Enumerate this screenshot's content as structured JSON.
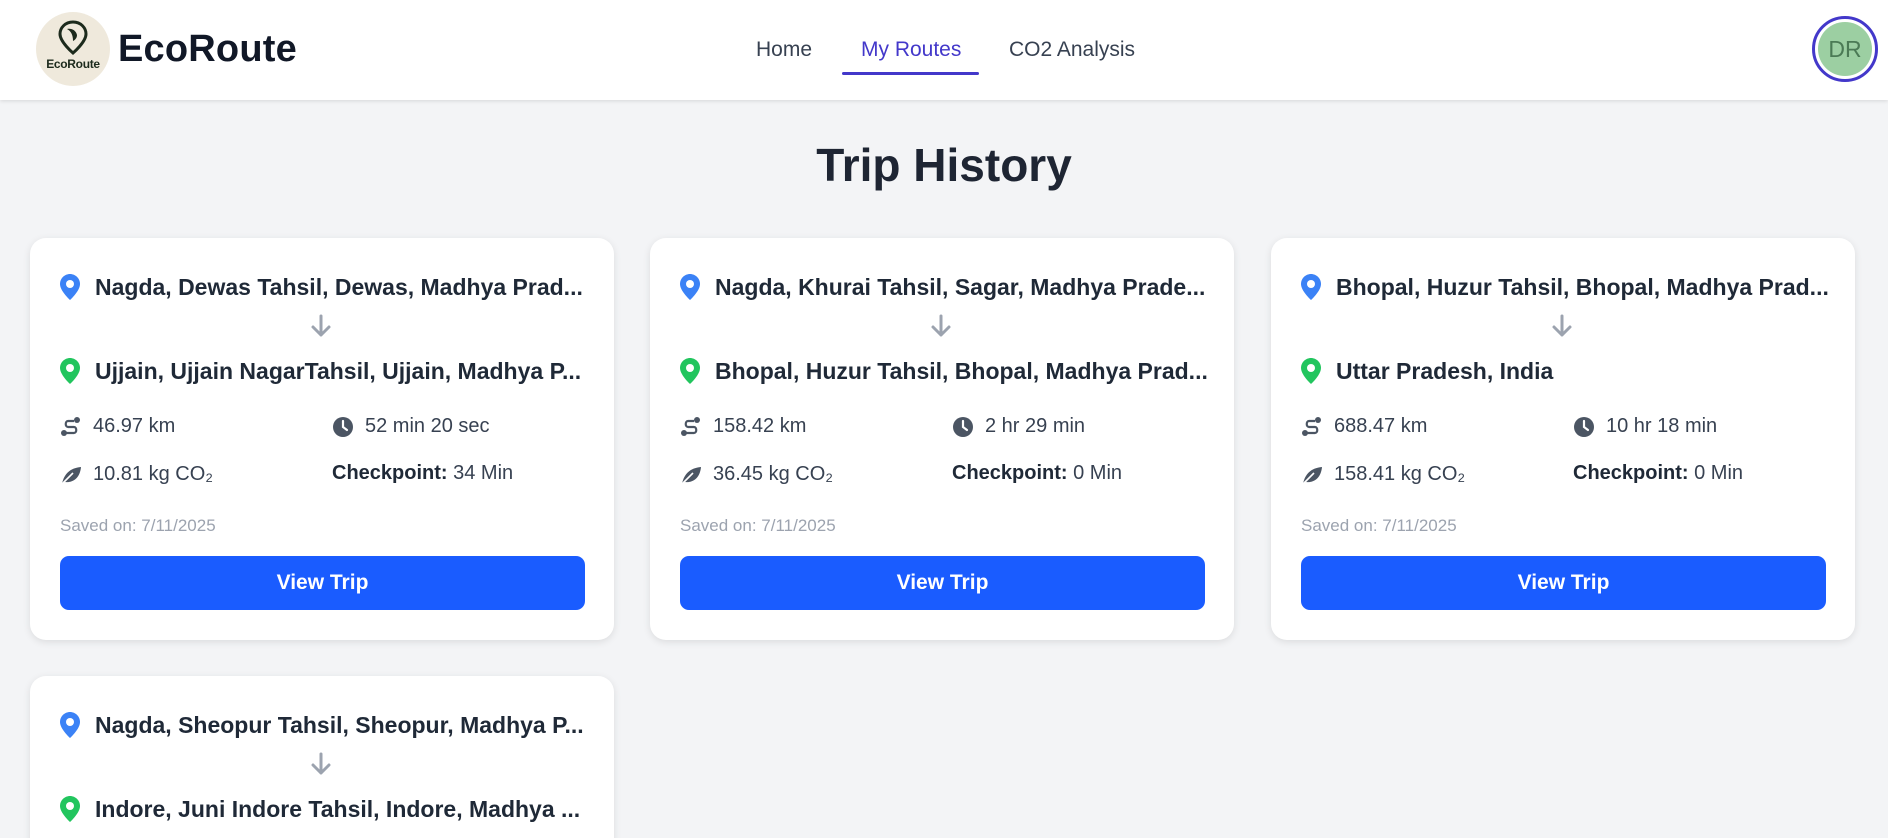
{
  "app": {
    "logo_text": "EcoRoute",
    "brand": "EcoRoute"
  },
  "nav": {
    "items": [
      {
        "label": "Home",
        "active": false
      },
      {
        "label": "My Routes",
        "active": true
      },
      {
        "label": "CO2 Analysis",
        "active": false
      }
    ]
  },
  "user": {
    "initials": "DR"
  },
  "page": {
    "title": "Trip History"
  },
  "labels": {
    "checkpoint": "Checkpoint:",
    "view_trip": "View Trip"
  },
  "colors": {
    "accent": "#4338ca",
    "button": "#1a5cff",
    "origin_pin": "#3b82f6",
    "destination_pin": "#22c55e"
  },
  "trips": [
    {
      "from": "Nagda, Dewas Tahsil, Dewas, Madhya Prad...",
      "to": "Ujjain, Ujjain NagarTahsil, Ujjain, Madhya P...",
      "distance": "46.97 km",
      "duration": "52 min 20 sec",
      "co2": "10.81 kg CO₂",
      "checkpoint": "34 Min",
      "saved": "Saved on: 7/11/2025"
    },
    {
      "from": "Nagda, Khurai Tahsil, Sagar, Madhya Prade...",
      "to": "Bhopal, Huzur Tahsil, Bhopal, Madhya Prad...",
      "distance": "158.42 km",
      "duration": "2 hr 29 min",
      "co2": "36.45 kg CO₂",
      "checkpoint": "0 Min",
      "saved": "Saved on: 7/11/2025"
    },
    {
      "from": "Bhopal, Huzur Tahsil, Bhopal, Madhya Prad...",
      "to": "Uttar Pradesh, India",
      "distance": "688.47 km",
      "duration": "10 hr 18 min",
      "co2": "158.41 kg CO₂",
      "checkpoint": "0 Min",
      "saved": "Saved on: 7/11/2025"
    },
    {
      "from": "Nagda, Sheopur Tahsil, Sheopur, Madhya P...",
      "to": "Indore, Juni Indore Tahsil, Indore, Madhya ..."
    }
  ]
}
